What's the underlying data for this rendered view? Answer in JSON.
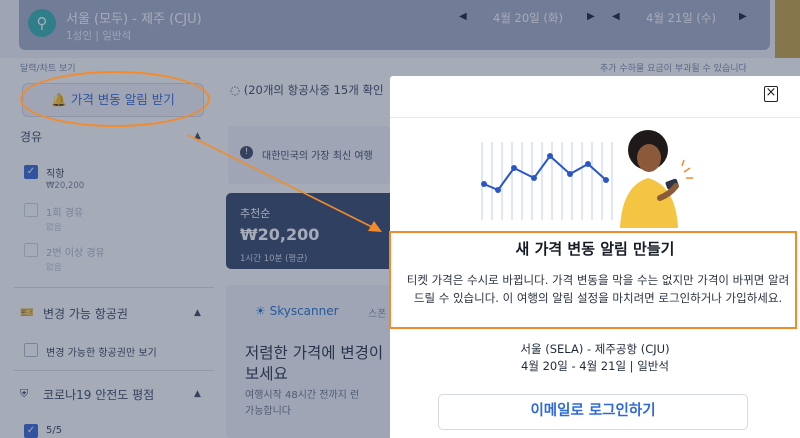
{
  "search_bar": {
    "route": "서울 (모두) - 제주 (CJU)",
    "passengers": "1성인 | 일반석",
    "depart_date": "4월 20일 (화)",
    "return_date": "4월 21일 (수)"
  },
  "links": {
    "calendar_chart": "달력/차트 보기",
    "fees_note": "추가 수하물 요금이 부과될 수 있습니다"
  },
  "price_alert_button": "가격 변동 알림 받기",
  "filters": {
    "stops": {
      "title": "경유",
      "options": [
        {
          "label": "직항",
          "price": "₩20,200",
          "checked": true
        },
        {
          "label": "1회 경유",
          "price": "없음",
          "checked": false
        },
        {
          "label": "2번 이상 경유",
          "price": "없음",
          "checked": false
        }
      ]
    },
    "flexible": {
      "title": "변경 가능 항공권",
      "option": "변경 가능한 항공권만 보기"
    },
    "covid": {
      "title": "코로나19 안전도 평점",
      "option": "5/5"
    }
  },
  "results": {
    "loading_text": "(20개의 항공사중 15개 확인",
    "info_text": "대한민국의 가장 최신 여행",
    "recommended_label": "추천순",
    "recommended_price": "₩20,200",
    "recommended_time": "1시간 10분 (평균)",
    "ad_brand": "Skyscanner",
    "ad_tag": "스폰",
    "ad_headline_1": "저렴한 가격에 변경이",
    "ad_headline_2": "보세요",
    "ad_sub_1": "여행시작 48시간 전까지 런",
    "ad_sub_2": "가능합니다"
  },
  "modal": {
    "title": "새 가격 변동 알림 만들기",
    "description": "티켓 가격은 수시로 바뀝니다. 가격 변동을 막을 수는 없지만 가격이 바뀌면 알려드릴 수 있습니다. 이 여행의 알림 설정을 마치려면 로그인하거나 가입하세요.",
    "route": "서울 (SELA) - 제주공항 (CJU)",
    "dates": "4월 20일 - 4월 21일 | 일반석",
    "email_login_button": "이메일로 로그인하기"
  },
  "colors": {
    "accent_blue": "#2f6ad8",
    "annotation_orange": "#f38b2a",
    "search_teal": "#3ab4b2"
  }
}
